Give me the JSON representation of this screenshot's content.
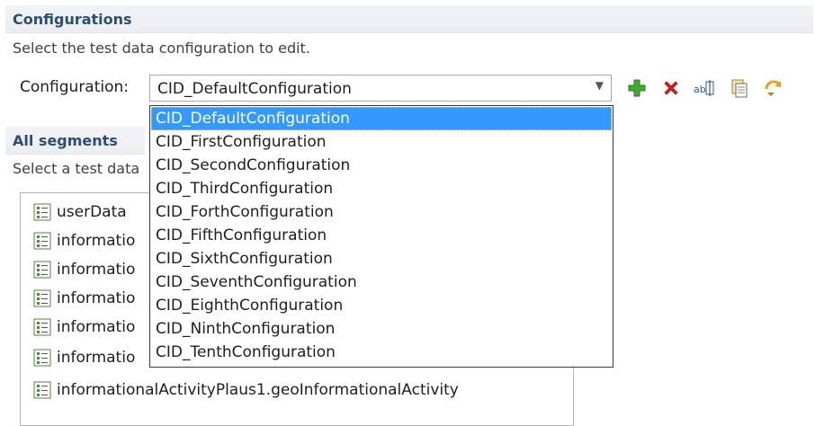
{
  "configurations": {
    "title": "Configurations",
    "description": "Select the test data configuration to edit.",
    "label": "Configuration:",
    "selected": "CID_DefaultConfiguration",
    "options": [
      "CID_DefaultConfiguration",
      "CID_FirstConfiguration",
      "CID_SecondConfiguration",
      "CID_ThirdConfiguration",
      "CID_ForthConfiguration",
      "CID_FifthConfiguration",
      "CID_SixthConfiguration",
      "CID_SeventhConfiguration",
      "CID_EighthConfiguration",
      "CID_NinthConfiguration",
      "CID_TenthConfiguration"
    ]
  },
  "toolbar": {
    "icons": [
      "add-icon",
      "delete-icon",
      "rename-icon",
      "copy-icon",
      "revert-icon"
    ],
    "colors": {
      "add": "#44a832",
      "delete": "#d81e1e",
      "revert": "#e6a020"
    }
  },
  "segments": {
    "title": "All segments",
    "description": "Select a test data",
    "items": [
      "userData",
      "informatio",
      "informatio",
      "informatio",
      "informatio",
      "informatio",
      "informationalActivityPlaus1.geoInformationalActivity"
    ]
  }
}
